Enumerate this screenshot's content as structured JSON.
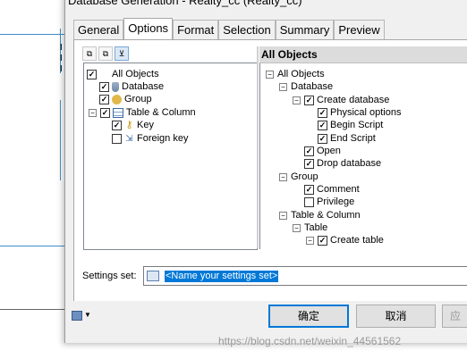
{
  "window": {
    "title": "Database Generation - Realty_cc (Realty_cc)"
  },
  "tabs": [
    {
      "label": "General"
    },
    {
      "label": "Options"
    },
    {
      "label": "Format"
    },
    {
      "label": "Selection"
    },
    {
      "label": "Summary"
    },
    {
      "label": "Preview"
    }
  ],
  "active_tab": "Options",
  "left_tree": {
    "items": [
      {
        "label": "All Objects",
        "checked": true
      },
      {
        "label": "Database",
        "checked": true
      },
      {
        "label": "Group",
        "checked": true
      },
      {
        "label": "Table & Column",
        "checked": true
      },
      {
        "label": "Key",
        "checked": true
      },
      {
        "label": "Foreign key",
        "checked": false
      }
    ]
  },
  "right_panel": {
    "header": "All Objects",
    "items": [
      {
        "label": "All Objects",
        "checked": null
      },
      {
        "label": "Database",
        "checked": null
      },
      {
        "label": "Create database",
        "checked": true
      },
      {
        "label": "Physical options",
        "checked": true
      },
      {
        "label": "Begin Script",
        "checked": true
      },
      {
        "label": "End Script",
        "checked": true
      },
      {
        "label": "Open",
        "checked": true
      },
      {
        "label": "Drop database",
        "checked": true
      },
      {
        "label": "Group",
        "checked": null
      },
      {
        "label": "Comment",
        "checked": true
      },
      {
        "label": "Privilege",
        "checked": false
      },
      {
        "label": "Table & Column",
        "checked": null
      },
      {
        "label": "Table",
        "checked": null
      },
      {
        "label": "Create table",
        "checked": true
      }
    ]
  },
  "settings": {
    "label": "Settings set:",
    "value": "<Name your settings set>"
  },
  "buttons": {
    "ok": "确定",
    "cancel": "取消",
    "apply": "应"
  },
  "watermark": "https://blog.csdn.net/weixin_44561562"
}
